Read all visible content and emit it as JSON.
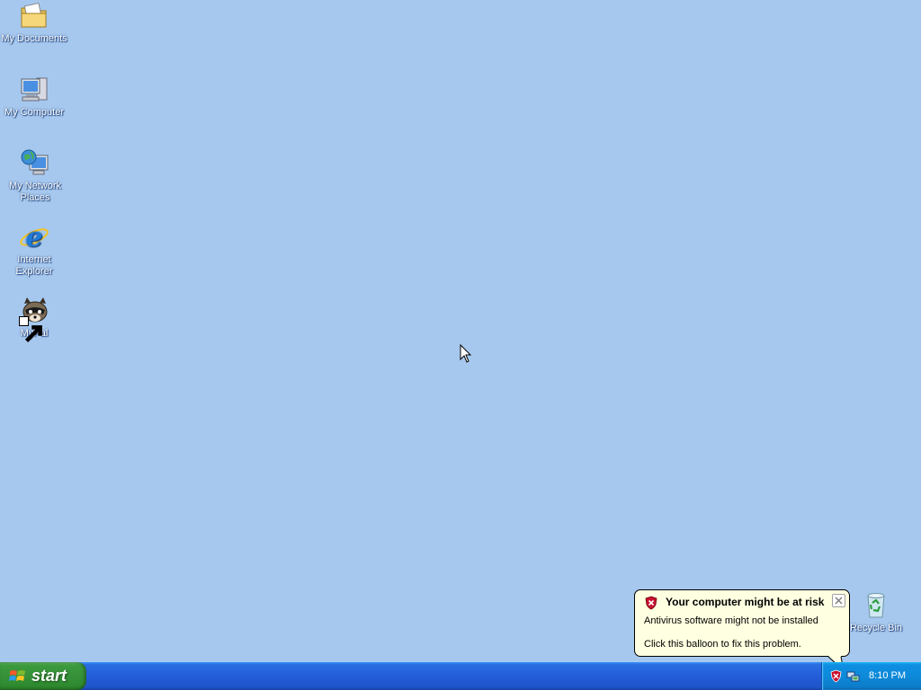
{
  "desktop": {
    "icons": [
      {
        "label": "My Documents"
      },
      {
        "label": "My Computer"
      },
      {
        "label": "My Network Places"
      },
      {
        "label": "Internet Explorer"
      },
      {
        "label": "MyPal"
      },
      {
        "label": "Recycle Bin"
      }
    ]
  },
  "taskbar": {
    "start_label": "start",
    "clock": "8:10 PM"
  },
  "balloon": {
    "title": "Your computer might be at risk",
    "line1": "Antivirus software might not be installed",
    "line2": "Click this balloon to fix this problem."
  },
  "icons": {
    "my_documents": "folder-documents-icon",
    "my_computer": "computer-icon",
    "network": "network-places-icon",
    "ie": "internet-explorer-icon",
    "mypal": "mypal-raccoon-icon",
    "recycle": "recycle-bin-icon",
    "security": "security-shield-icon",
    "network_tray": "network-connection-icon"
  },
  "colors": {
    "desktop_bg": "#a6c8ee",
    "taskbar": "#245edb",
    "start_green": "#36913a",
    "balloon_bg": "#ffffe1",
    "alert_red": "#c8102e"
  }
}
